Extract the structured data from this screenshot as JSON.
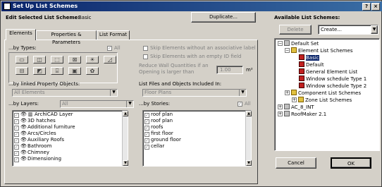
{
  "window": {
    "title": "Set Up List Schemes"
  },
  "header": {
    "edit_label": "Edit Selected List Scheme:",
    "scheme_name": "Basic",
    "duplicate_label": "Duplicate..."
  },
  "tabs": [
    "Elements",
    "Properties & Parameters",
    "List Format"
  ],
  "types": {
    "label": "...by Types:",
    "all_label": "All"
  },
  "skip": {
    "assoc": "Skip Elements without an associative label",
    "empty_id": "Skip Elements with an empty ID field",
    "reduce_line1": "Reduce Wall Quantities if an",
    "reduce_line2": "Opening is larger than",
    "reduce_value": "1.00",
    "reduce_unit": "m²"
  },
  "linked": {
    "label": "...by linked Property Objects:",
    "value": "All Elements"
  },
  "files": {
    "label": "List Files and Objects Included In:",
    "value": "Floor Plans"
  },
  "layers": {
    "label": "...by Layers:",
    "combo": "All",
    "items": [
      "ArchiCAD Layer",
      "3D hatches",
      "Additional furniture",
      "Arcs/Circles",
      "Auxiliary Roofs",
      "Bathroom",
      "Chimney",
      "Dimensioning"
    ]
  },
  "stories": {
    "label": "...by Stories:",
    "all_label": "All",
    "items": [
      "roof plan",
      "roof plan",
      "roofs",
      "first floor",
      "ground floor",
      "cellar"
    ]
  },
  "available": {
    "label": "Available List Schemes:",
    "delete_label": "Delete",
    "create_label": "Create..."
  },
  "tree": {
    "items": [
      "Default Set",
      "Element List Schemes",
      "Basic",
      "Default",
      "General Element List",
      "Window schedule Type 1",
      "Window schedule Type 2",
      "Component List Schemes",
      "Zone List Schemes",
      "AC_8_INT",
      "RoofMaker 2.1"
    ]
  },
  "footer": {
    "cancel_label": "Cancel",
    "ok_label": "OK"
  },
  "colors": {
    "titlebar": "#0a246a",
    "face": "#d4d0c8",
    "selection": "#0a246a"
  }
}
